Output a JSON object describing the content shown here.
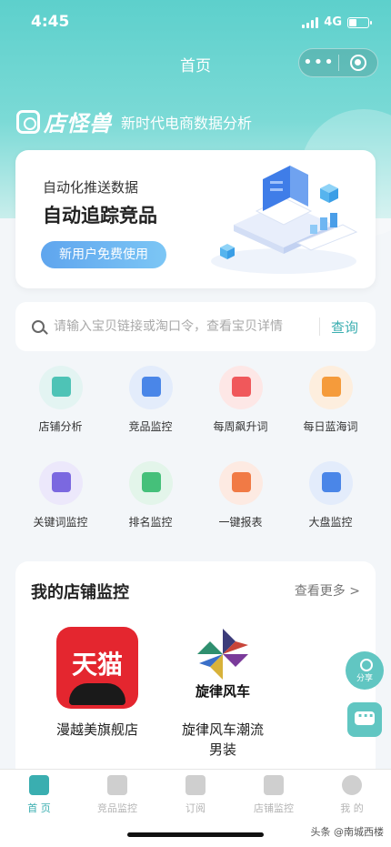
{
  "status_bar": {
    "time": "4:45",
    "network": "4G"
  },
  "nav": {
    "title": "首页",
    "more_glyph": "•••"
  },
  "brand": {
    "name": "店怪兽",
    "slogan": "新时代电商数据分析"
  },
  "banner": {
    "subtitle": "自动化推送数据",
    "title": "自动追踪竞品",
    "button": "新用户免费使用"
  },
  "search": {
    "placeholder": "请输入宝贝链接或淘口令，查看宝贝详情",
    "button": "查询"
  },
  "features": [
    {
      "label": "店铺分析",
      "icon": "shop-icon",
      "bg": "#e3f4f2",
      "fg": "#4ec3b6"
    },
    {
      "label": "竞品监控",
      "icon": "monitor-icon",
      "bg": "#e3ecfb",
      "fg": "#4a86e8"
    },
    {
      "label": "每周飙升词",
      "icon": "bag-icon",
      "bg": "#fde7e6",
      "fg": "#f0585b"
    },
    {
      "label": "每日蓝海词",
      "icon": "letter-a-icon",
      "bg": "#fdeede",
      "fg": "#f59b3b"
    },
    {
      "label": "关键词监控",
      "icon": "book-icon",
      "bg": "#ece8fb",
      "fg": "#7b68e0"
    },
    {
      "label": "排名监控",
      "icon": "trophy-icon",
      "bg": "#e3f5ea",
      "fg": "#45c07a"
    },
    {
      "label": "一键报表",
      "icon": "report-icon",
      "bg": "#fdeae2",
      "fg": "#f17a45"
    },
    {
      "label": "大盘监控",
      "icon": "server-icon",
      "bg": "#e3ecfb",
      "fg": "#4a86e8"
    }
  ],
  "monitor": {
    "title": "我的店铺监控",
    "more": "查看更多 >",
    "shops": [
      {
        "name": "漫越美旗舰店",
        "logo_text": "天猫",
        "logo_color": "#e4262f"
      },
      {
        "name_line1": "旋律风车潮流",
        "name_line2": "男装",
        "logo_text": "旋律风车"
      }
    ]
  },
  "share_fab": {
    "label": "分享"
  },
  "tabbar": [
    {
      "label": "首 页",
      "active": true
    },
    {
      "label": "竞品监控",
      "active": false
    },
    {
      "label": "订阅",
      "active": false
    },
    {
      "label": "店铺监控",
      "active": false
    },
    {
      "label": "我 的",
      "active": false
    }
  ],
  "watermark": "头条 @南城西楼",
  "colors": {
    "accent": "#3aaeb0",
    "header": "#5dd0cc"
  }
}
